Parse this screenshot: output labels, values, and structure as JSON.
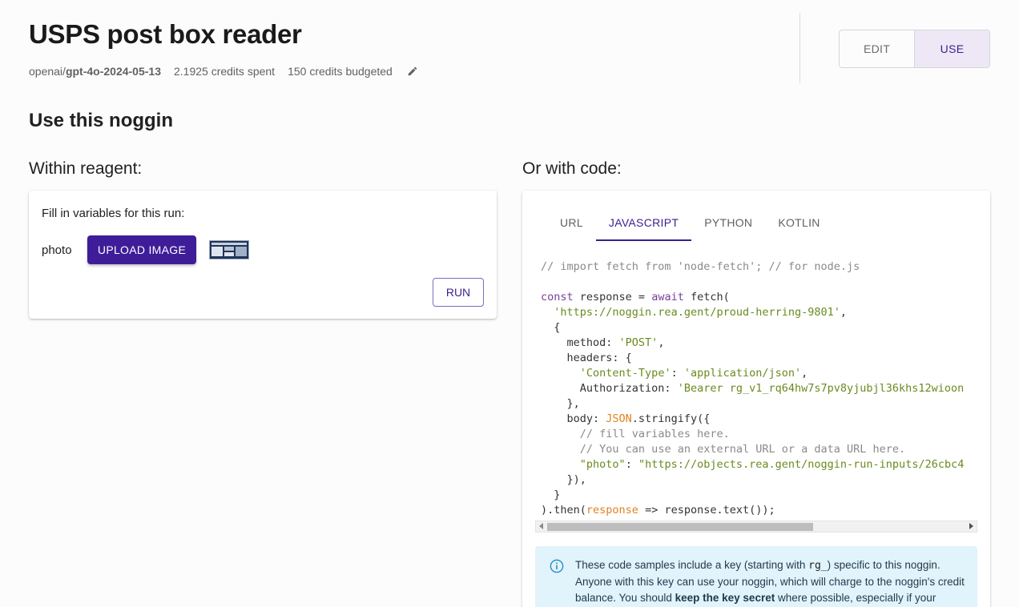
{
  "header": {
    "title": "USPS post box reader",
    "model_provider": "openai/",
    "model_name": "gpt-4o-2024-05-13",
    "credits_spent": "2.1925 credits spent",
    "credits_budgeted": "150 credits budgeted",
    "edit_icon": "pencil-icon"
  },
  "mode_toggle": {
    "edit_label": "EDIT",
    "use_label": "USE",
    "selected": "USE"
  },
  "section_title": "Use this noggin",
  "within": {
    "heading": "Within reagent:",
    "fill_label": "Fill in variables for this run:",
    "variable_name": "photo",
    "upload_label": "UPLOAD IMAGE",
    "run_label": "RUN"
  },
  "code_panel": {
    "heading": "Or with code:",
    "tabs": [
      "URL",
      "JAVASCRIPT",
      "PYTHON",
      "KOTLIN"
    ],
    "active_tab": "JAVASCRIPT",
    "lines": {
      "l1": "// import fetch from 'node-fetch'; // for node.js",
      "l2_kw": "const",
      "l2_rest": " response = ",
      "l2_await": "await",
      "l2_end": " fetch(",
      "l3": "'https://noggin.rea.gent/proud-herring-9801'",
      "l3_end": ",",
      "l4": "  {",
      "l5_key": "    method: ",
      "l5_val": "'POST'",
      "l5_end": ",",
      "l6": "    headers: {",
      "l7_key": "'Content-Type'",
      "l7_mid": ": ",
      "l7_val": "'application/json'",
      "l7_end": ",",
      "l8_key": "      Authorization: ",
      "l8_val": "'Bearer rg_v1_rq64hw7s7pv8yjubjl36khs12wioon",
      "l9": "    },",
      "l10_key": "    body: ",
      "l10_obj": "JSON",
      "l10_end": ".stringify({",
      "l11": "// fill variables here.",
      "l12": "// You can use an external URL or a data URL here.",
      "l13_key": "\"photo\"",
      "l13_mid": ": ",
      "l13_val": "\"https://objects.rea.gent/noggin-run-inputs/26cbc4",
      "l14": "    }),",
      "l15": "  }",
      "l16_a": ").then(",
      "l16_b": "response",
      "l16_c": " => response.text());"
    }
  },
  "info": {
    "p1": "These code samples include a key (starting with ",
    "code": "rg_",
    "p2": ") specific to this noggin. Anyone with this key can use your noggin, which will charge to the noggin's credit balance. You should ",
    "bold": "keep the key secret",
    "p3": " where possible, especially if your"
  }
}
